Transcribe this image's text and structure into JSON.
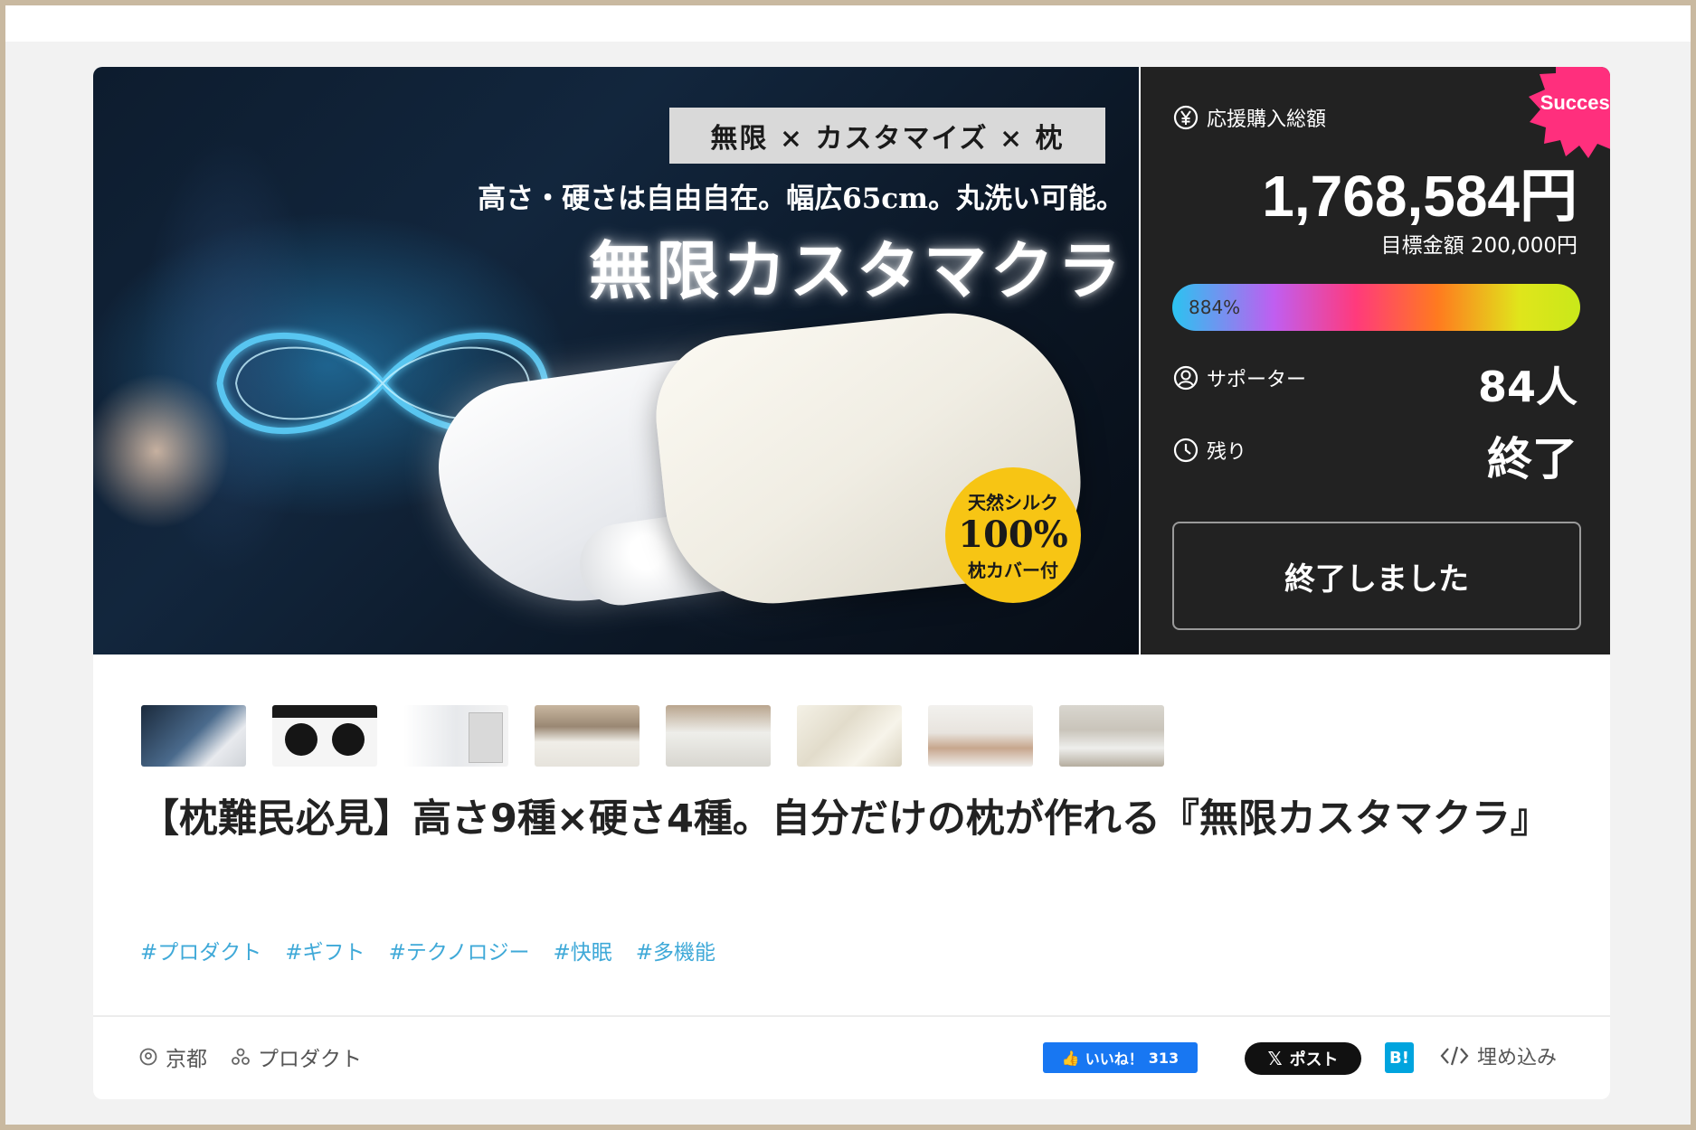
{
  "hero": {
    "tagline_box": "無限 × カスタマイズ × 枕",
    "subline": "高さ・硬さは自由自在。幅広65cm。丸洗い可能。",
    "product_name": "無限カスタマクラ",
    "badge_line1": "天然シルク",
    "badge_line2": "100%",
    "badge_line3": "枕カバー付"
  },
  "stats": {
    "success_label": "Success!",
    "total_label": "応援購入総額",
    "total_amount": "1,768,584円",
    "goal_text": "目標金額 200,000円",
    "progress_percent_text": "884%",
    "progress_percent": 884,
    "supporters_label": "サポーター",
    "supporters_value": "84人",
    "remaining_label": "残り",
    "remaining_value": "終了",
    "ended_button": "終了しました"
  },
  "thumbnails": [
    {
      "name": "thumbnail-1"
    },
    {
      "name": "thumbnail-2"
    },
    {
      "name": "thumbnail-3"
    },
    {
      "name": "thumbnail-4"
    },
    {
      "name": "thumbnail-5"
    },
    {
      "name": "thumbnail-6"
    },
    {
      "name": "thumbnail-7"
    },
    {
      "name": "thumbnail-8"
    }
  ],
  "project_title": "【枕難民必見】高さ9種×硬さ4種。自分だけの枕が作れる『無限カスタマクラ』",
  "tags": [
    "#プロダクト",
    "#ギフト",
    "#テクノロジー",
    "#快眠",
    "#多機能"
  ],
  "meta": {
    "location": "京都",
    "category": "プロダクト"
  },
  "share": {
    "fb_label": "いいね！",
    "fb_count": "313",
    "x_label": "ポスト",
    "hatena_label": "B!",
    "embed_label": "埋め込み"
  },
  "colors": {
    "accent_tag": "#3fa9d8",
    "success_badge": "#ff2f7d",
    "stats_bg": "#222222",
    "fb_blue": "#1877f2"
  }
}
